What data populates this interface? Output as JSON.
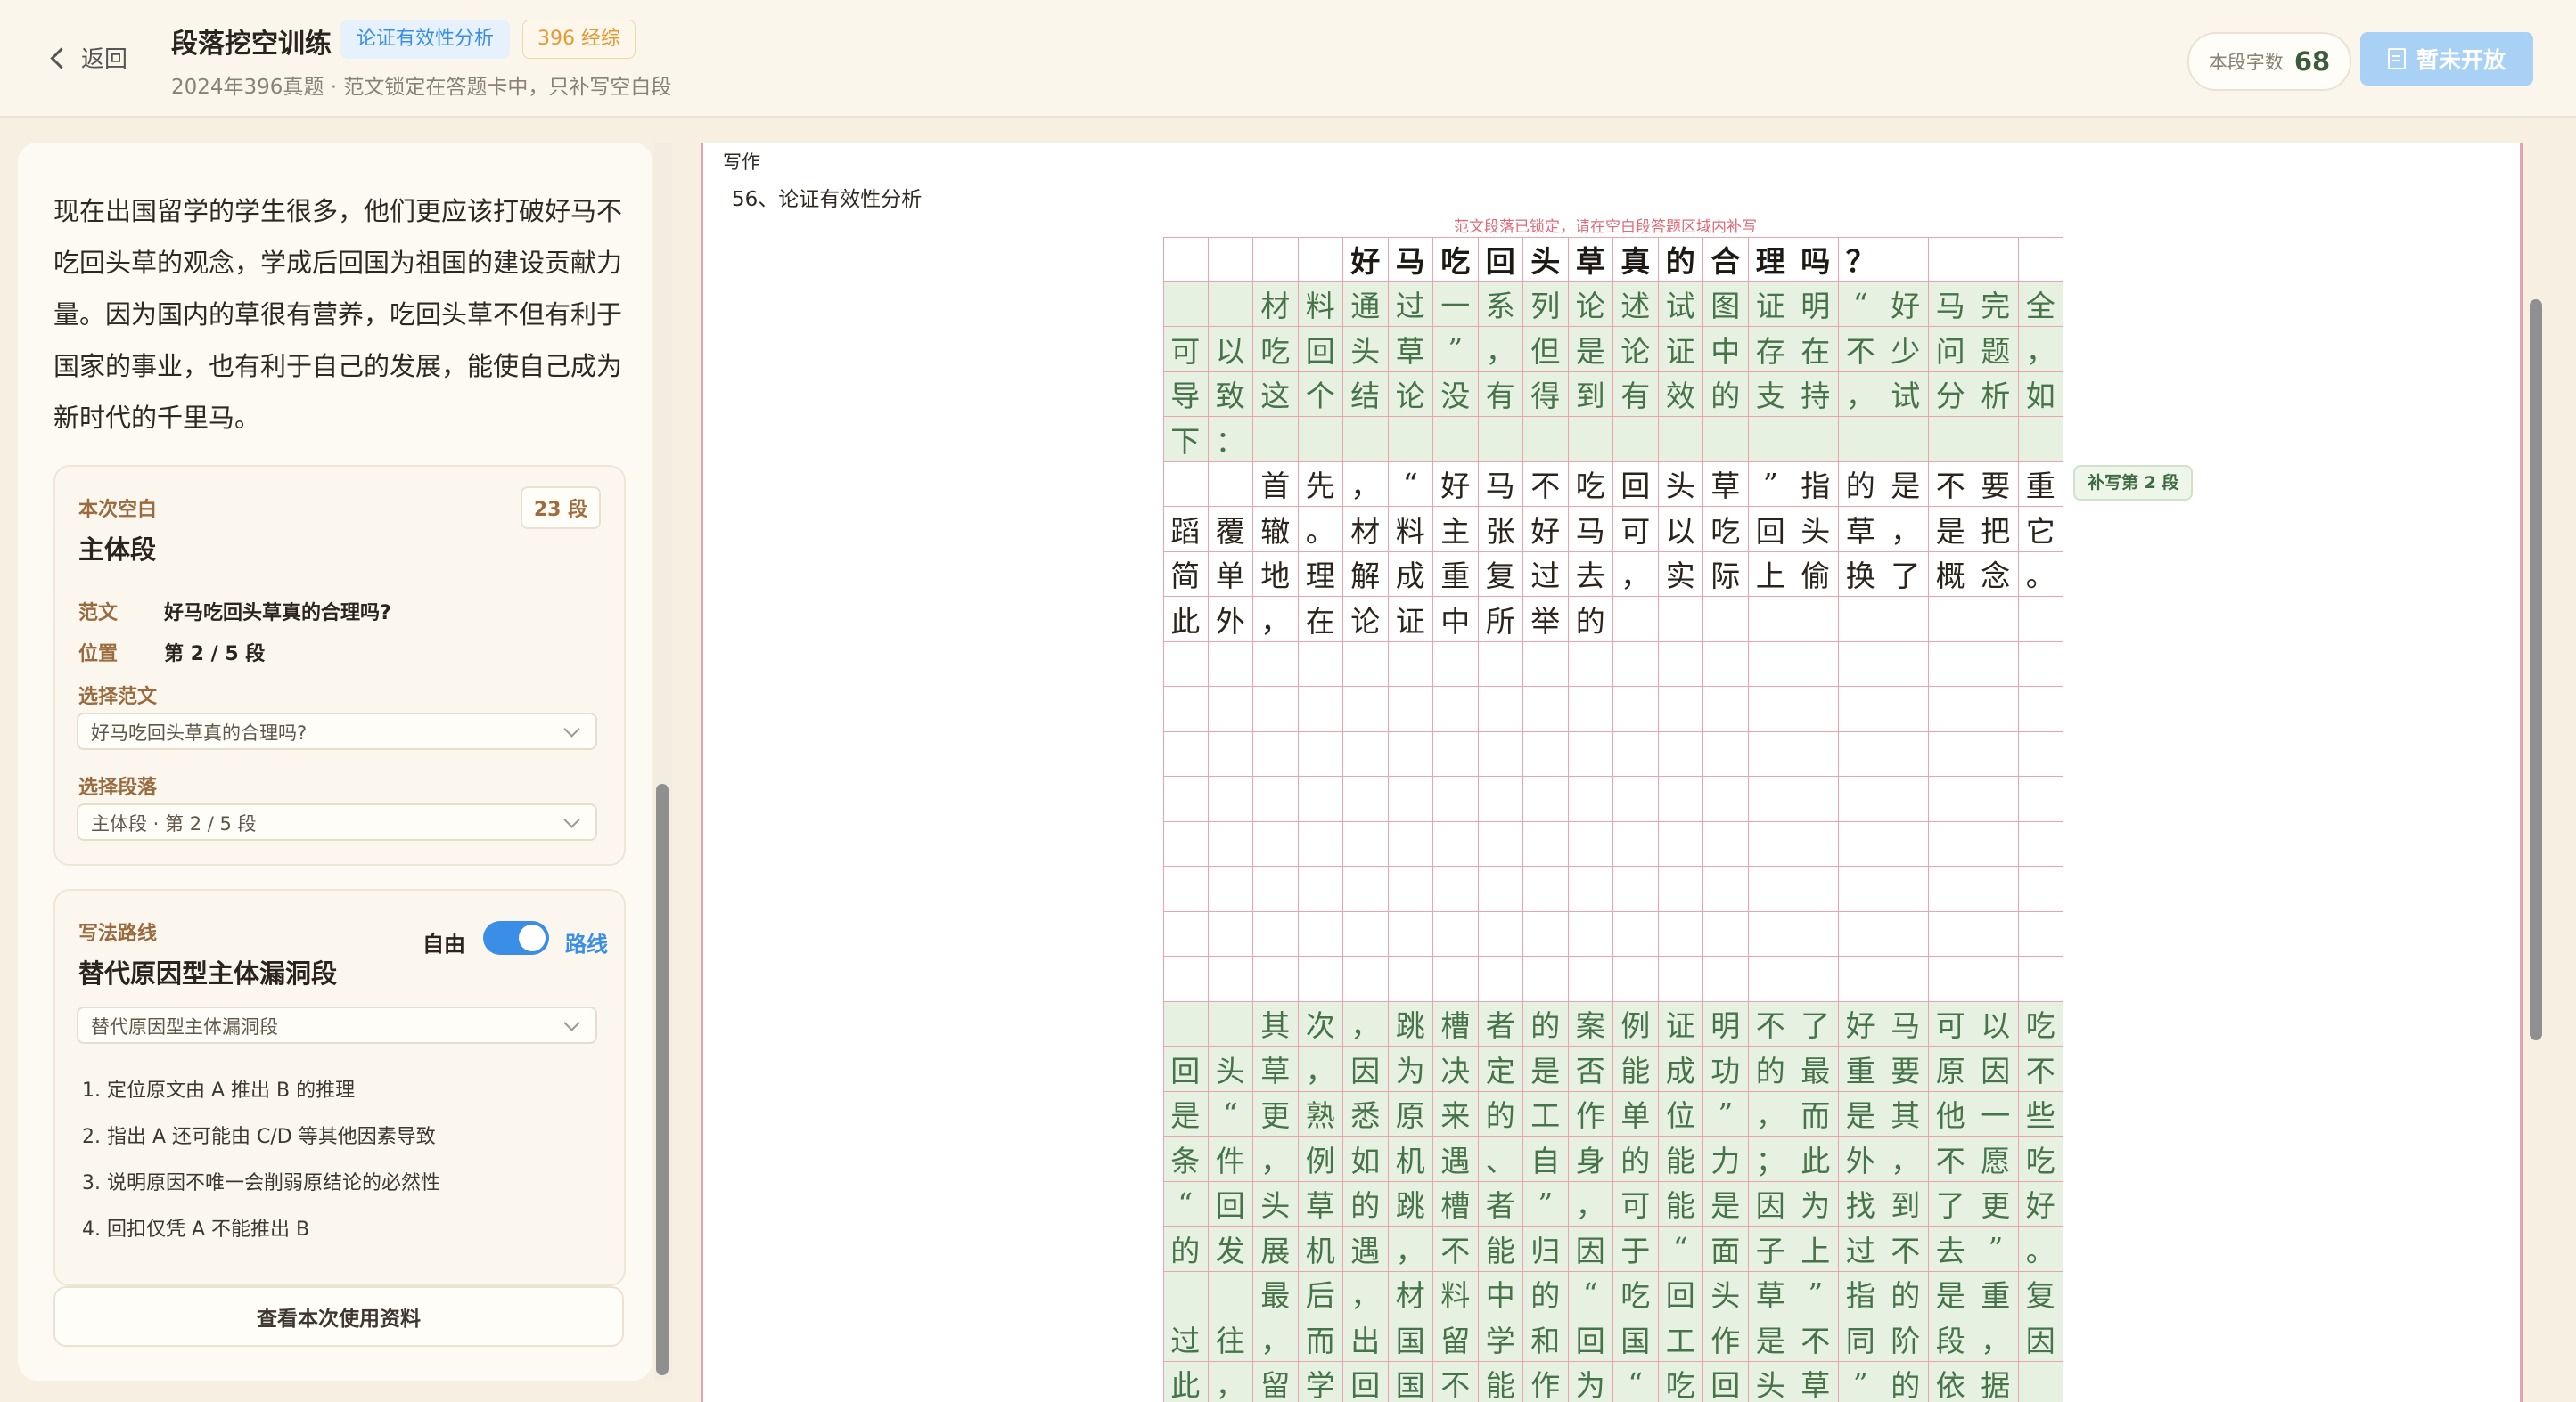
{
  "header": {
    "back_label": "返回",
    "title": "段落挖空训练",
    "tag_type": "论证有效性分析",
    "tag_exam": "396 经综",
    "subtitle": "2024年396真题 · 范文锁定在答题卡中，只补写空白段",
    "wordcount_label": "本段字数",
    "wordcount_value": "68",
    "submit_label": "暂未开放"
  },
  "left": {
    "passage": "现在出国留学的学生很多，他们更应该打破好马不吃回头草的观念，学成后回国为祖国的建设贡献力量。因为国内的草很有营养，吃回头草不但有利于国家的事业，也有利于自己的发展，能使自己成为新时代的千里马。",
    "blank_card": {
      "label": "本次空白",
      "paragraph_count": "23 段",
      "title": "主体段",
      "essay_key": "范文",
      "essay_value": "好马吃回头草真的合理吗?",
      "position_key": "位置",
      "position_value": "第 2 / 5 段",
      "choose_essay_label": "选择范文",
      "choose_essay_value": "好马吃回头草真的合理吗?",
      "choose_para_label": "选择段落",
      "choose_para_value": "主体段 · 第 2 / 5 段"
    },
    "route_card": {
      "label": "写法路线",
      "title": "替代原因型主体漏洞段",
      "toggle_free": "自由",
      "toggle_route": "路线",
      "toggle_on": true,
      "select_value": "替代原因型主体漏洞段",
      "steps": [
        "1. 定位原文由 A 推出 B 的推理",
        "2. 指出 A 还可能由 C/D 等其他因素导致",
        "3. 说明原因不唯一会削弱原结论的必然性",
        "4. 回扣仅凭 A 不能推出 B"
      ]
    },
    "view_materials_label": "查看本次使用资料"
  },
  "sheet": {
    "section": "写作",
    "question": "56、论证有效性分析",
    "lock_note": "范文段落已锁定，请在空白段答题区域内补写",
    "side_tag": "补写第 2 段",
    "columns": 20,
    "rows_text": [
      {
        "text": "　　　　好马吃回头草真的合理吗？",
        "style": "title"
      },
      {
        "text": "　　材料通过一系列论述试图证明“好马完全可以吃回头草”，但是论证中存在不少问题，导致这个结论没有得到有效的支持，试分析如下：",
        "style": "locked"
      },
      {
        "text": "　　首先，“好马不吃回头草”指的是不要重蹈覆辙。材料主张好马可以吃回头草，是把它简单地理解成重复过去，实际上偷换了概念。此外，在论证中所举的",
        "style": "user",
        "rows": 12
      },
      {
        "text": "　　其次，跳槽者的案例证明不了好马可以吃回头草，因为决定是否能成功的最重要原因不是“更熟悉原来的工作单位”，而是其他一些条件，例如机遇、自身的能力；此外，不愿吃“回头草的跳槽者”，可能是因为找到了更好的发展机遇，不能归因于“面子上过不去”。",
        "style": "locked"
      },
      {
        "text": "　　最后，材料中的“吃回头草”指的是重复过往，而出国留学和回国工作是不同阶段，因此，留学回国不能作为“吃回头草”的依据",
        "style": "locked"
      }
    ]
  },
  "colors": {
    "accent_blue": "#3a8ee6",
    "grid_red": "#e9a4ae",
    "locked_green": "#e6f1e1",
    "locked_text": "#47734a"
  }
}
